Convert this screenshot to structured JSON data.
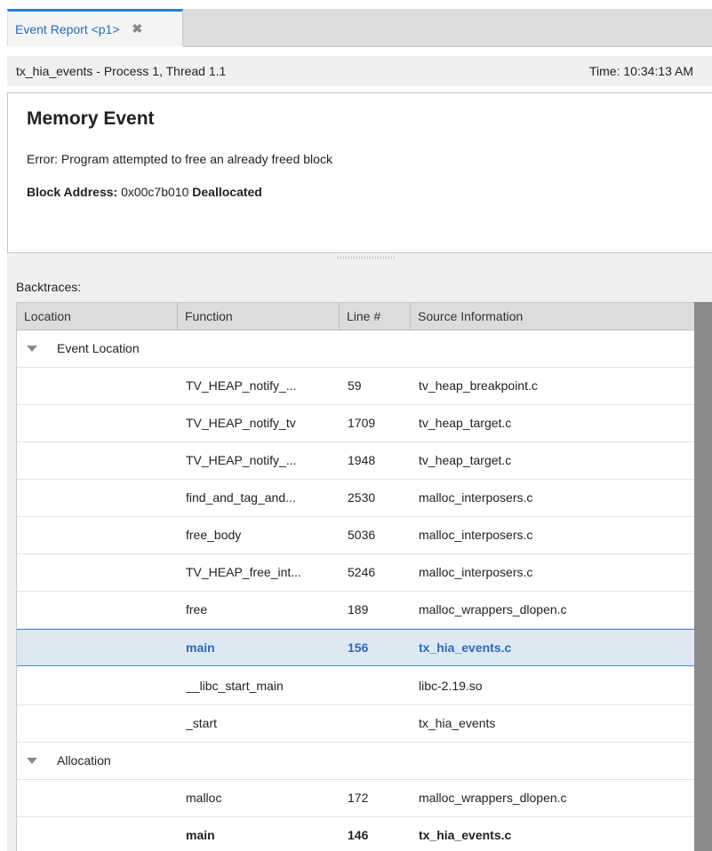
{
  "tab": {
    "label": "Event Report <p1>",
    "close": "✖"
  },
  "infobar": {
    "title": "tx_hia_events - Process 1, Thread 1.1",
    "time": "Time: 10:34:13 AM"
  },
  "event": {
    "heading": "Memory Event",
    "error": "Error: Program attempted to free an already freed block",
    "block_label": "Block Address:",
    "block_value": " 0x00c7b010 ",
    "block_state": "Deallocated"
  },
  "backtraces": {
    "label": "Backtraces:",
    "columns": [
      "Location",
      "Function",
      "Line #",
      "Source Information"
    ],
    "groups": [
      {
        "name": "Event Location",
        "rows": [
          {
            "function": "TV_HEAP_notify_...",
            "line": "59",
            "source": "tv_heap_breakpoint.c"
          },
          {
            "function": "TV_HEAP_notify_tv",
            "line": "1709",
            "source": "tv_heap_target.c"
          },
          {
            "function": "TV_HEAP_notify_...",
            "line": "1948",
            "source": "tv_heap_target.c"
          },
          {
            "function": "find_and_tag_and...",
            "line": "2530",
            "source": "malloc_interposers.c"
          },
          {
            "function": "free_body",
            "line": "5036",
            "source": "malloc_interposers.c"
          },
          {
            "function": "TV_HEAP_free_int...",
            "line": "5246",
            "source": "malloc_interposers.c"
          },
          {
            "function": "free",
            "line": "189",
            "source": "malloc_wrappers_dlopen.c"
          },
          {
            "function": "main",
            "line": "156",
            "source": "tx_hia_events.c"
          },
          {
            "function": "__libc_start_main",
            "line": "",
            "source": "libc-2.19.so"
          },
          {
            "function": "_start",
            "line": "",
            "source": "tx_hia_events"
          }
        ]
      },
      {
        "name": "Allocation",
        "rows": [
          {
            "function": "malloc",
            "line": "172",
            "source": "malloc_wrappers_dlopen.c"
          },
          {
            "function": "main",
            "line": "146",
            "source": "tx_hia_events.c"
          }
        ]
      }
    ]
  }
}
